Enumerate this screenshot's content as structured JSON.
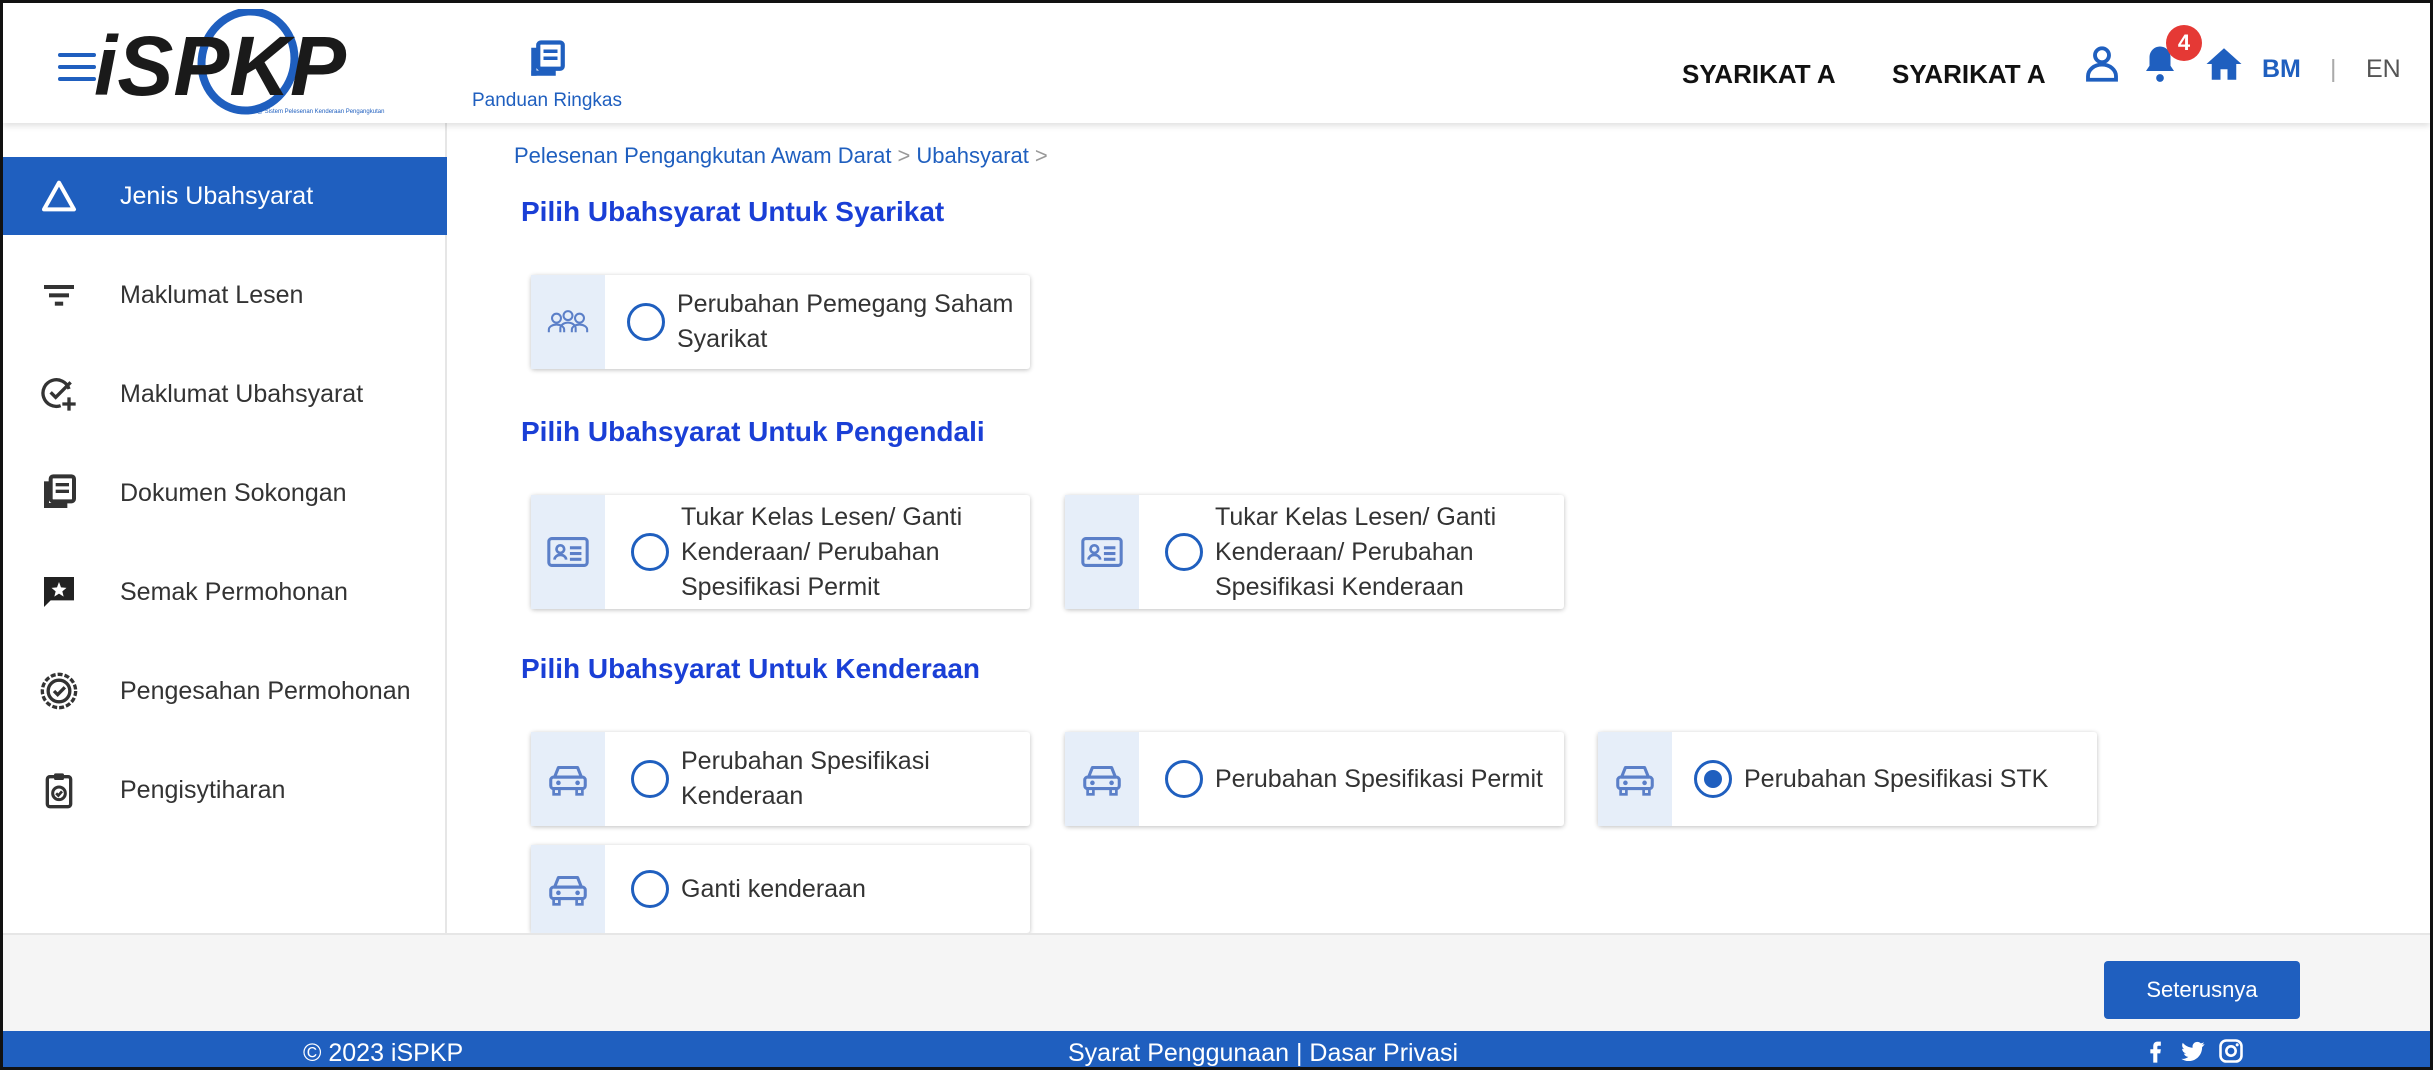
{
  "header": {
    "logo_text": "iSPKP",
    "logo_tagline": "iSPKP @ Sistem Pelesenan Kenderaan Pengangkutan",
    "guide_label": "Panduan Ringkas",
    "company_1": "SYARIKAT A",
    "company_2": "SYARIKAT A",
    "notification_count": "4",
    "lang_bm": "BM",
    "lang_separator": "|",
    "lang_en": "EN",
    "accent_color": "#1f5fbf",
    "badge_color": "#e53935"
  },
  "sidebar": {
    "items": [
      {
        "label": "Jenis Ubahsyarat",
        "icon": "triangle-icon",
        "active": true
      },
      {
        "label": "Maklumat Lesen",
        "icon": "filter-icon",
        "active": false
      },
      {
        "label": "Maklumat Ubahsyarat",
        "icon": "check-plus-icon",
        "active": false
      },
      {
        "label": "Dokumen Sokongan",
        "icon": "document-icon",
        "active": false
      },
      {
        "label": "Semak Permohonan",
        "icon": "chat-star-icon",
        "active": false
      },
      {
        "label": "Pengesahan Permohonan",
        "icon": "verified-badge-icon",
        "active": false
      },
      {
        "label": "Pengisytiharan",
        "icon": "clipboard-icon",
        "active": false
      }
    ]
  },
  "breadcrumb": {
    "item_1": "Pelesenan Pengangkutan Awam Darat",
    "sep_1": ">",
    "item_2": "Ubahsyarat",
    "sep_2": ">"
  },
  "sections": {
    "syarikat": {
      "title": "Pilih Ubahsyarat Untuk Syarikat",
      "options": [
        {
          "label": "Perubahan Pemegang Saham Syarikat",
          "icon": "people-icon",
          "checked": false
        }
      ]
    },
    "pengendali": {
      "title": "Pilih Ubahsyarat Untuk Pengendali",
      "options": [
        {
          "label": "Tukar Kelas Lesen/ Ganti Kenderaan/ Perubahan Spesifikasi Permit",
          "icon": "id-card-icon",
          "checked": false
        },
        {
          "label": "Tukar Kelas Lesen/ Ganti Kenderaan/ Perubahan Spesifikasi Kenderaan",
          "icon": "id-card-icon",
          "checked": false
        }
      ]
    },
    "kenderaan": {
      "title": "Pilih Ubahsyarat Untuk Kenderaan",
      "options": [
        {
          "label": "Perubahan Spesifikasi Kenderaan",
          "icon": "car-icon",
          "checked": false
        },
        {
          "label": "Perubahan Spesifikasi Permit",
          "icon": "car-icon",
          "checked": false
        },
        {
          "label": "Perubahan Spesifikasi STK",
          "icon": "car-icon",
          "checked": true
        },
        {
          "label": "Ganti kenderaan",
          "icon": "car-icon",
          "checked": false
        }
      ]
    }
  },
  "actions": {
    "next_label": "Seterusnya"
  },
  "footer": {
    "copyright": "© 2023 iSPKP",
    "links": "Syarat Penggunaan | Dasar Privasi",
    "social_icons": [
      "facebook-icon",
      "twitter-icon",
      "instagram-icon"
    ]
  }
}
